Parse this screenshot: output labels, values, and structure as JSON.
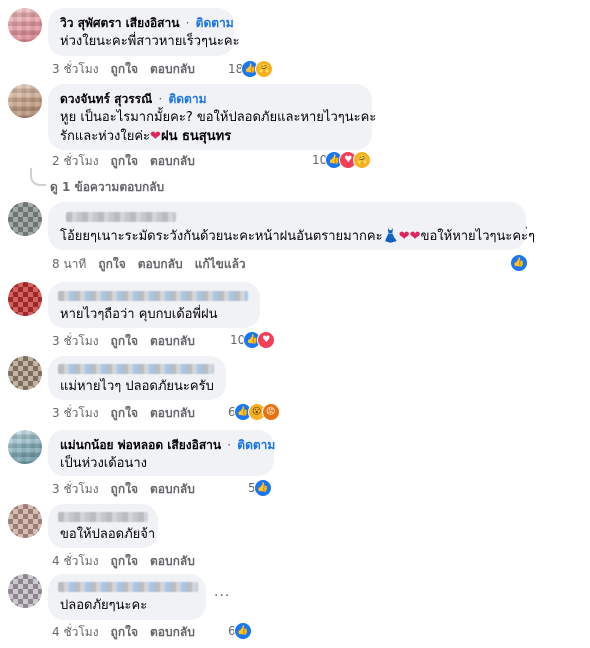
{
  "labels": {
    "like": "ถูกใจ",
    "reply": "ตอบกลับ",
    "edited": "แก้ไขแล้ว",
    "follow": "ติดตาม",
    "dot": "·"
  },
  "comments": [
    {
      "name": "วิว สุพัศตรา เสียงอิสาน",
      "follow": true,
      "text": "ห่วงใยนะคะพี่สาวหายเร็วๆนะคะ",
      "time": "3 ชั่วโมง",
      "reactions": "18"
    },
    {
      "name": "ดวงจันทร์ สุวรรณี",
      "follow": true,
      "text1": "หูย เป็นอะไรมากมั้ยคะ? ขอให้ปลอดภัยและหายไวๆนะคะ",
      "text2": "รักและห่วงใยค่ะ",
      "text2_tag": "ฝน ธนสุนทร",
      "time": "2 ชั่วโมง",
      "reactions": "10"
    },
    {
      "text": "โอ้ยยๆเนาะระมัดระวังกันด้วยนะคะหน้าฝนอันตรายมากคะ",
      "text_tail": "ขอให้หายไวๆนะคะ่ๆ",
      "time": "8 นาที"
    },
    {
      "text": "หายไวๆถือว่า คุบกบเด้อพี่ฝน",
      "time": "3 ชั่วโมง",
      "reactions": "10"
    },
    {
      "text": "แม่หายไวๆ ปลอดภัยนะครับ",
      "time": "3 ชั่วโมง",
      "reactions": "6"
    },
    {
      "name": "แม่นกน้อย พ่อหลอด เสียงอิสาน",
      "follow": true,
      "text": "เป็นห่วงเด้อนาง",
      "time": "3 ชั่วโมง",
      "reactions": "5"
    },
    {
      "text": "ขอให้ปลอดภัยจ้า",
      "time": "4 ชั่วโมง"
    },
    {
      "text": "ปลอดภัยๆนะคะ",
      "time": "4 ชั่วโมง",
      "reactions": "6"
    }
  ],
  "view_replies": "ดู 1 ข้อความตอบกลับ",
  "more_menu": "...",
  "icons": [
    "like-icon",
    "love-icon",
    "care-icon",
    "wow-icon",
    "angry-icon",
    "heart-icon",
    "dress-icon"
  ]
}
